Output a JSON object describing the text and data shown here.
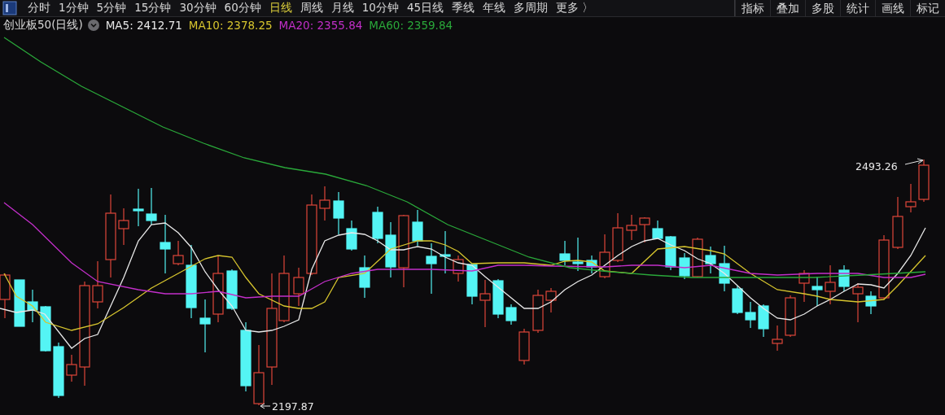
{
  "period_tabs": [
    {
      "label": "分时",
      "selected": false
    },
    {
      "label": "1分钟",
      "selected": false
    },
    {
      "label": "5分钟",
      "selected": false
    },
    {
      "label": "15分钟",
      "selected": false
    },
    {
      "label": "30分钟",
      "selected": false
    },
    {
      "label": "60分钟",
      "selected": false
    },
    {
      "label": "日线",
      "selected": true
    },
    {
      "label": "周线",
      "selected": false
    },
    {
      "label": "月线",
      "selected": false
    },
    {
      "label": "10分钟",
      "selected": false
    },
    {
      "label": "45日线",
      "selected": false
    },
    {
      "label": "季线",
      "selected": false
    },
    {
      "label": "年线",
      "selected": false
    },
    {
      "label": "多周期",
      "selected": false
    },
    {
      "label": "更多 〉",
      "selected": false
    }
  ],
  "tools": [
    "指标",
    "叠加",
    "多股",
    "统计",
    "画线",
    "标记"
  ],
  "legend": {
    "title": "创业板50(日线)",
    "indicators": [
      {
        "label": "MA5: 2412.71",
        "color": "#e8e8e8"
      },
      {
        "label": "MA10: 2378.25",
        "color": "#d7c52e"
      },
      {
        "label": "MA20: 2355.84",
        "color": "#c22fc9"
      },
      {
        "label": "MA60: 2359.84",
        "color": "#2aa83a"
      }
    ]
  },
  "chart": {
    "high_label": "2493.26",
    "low_label": "2197.87"
  }
}
